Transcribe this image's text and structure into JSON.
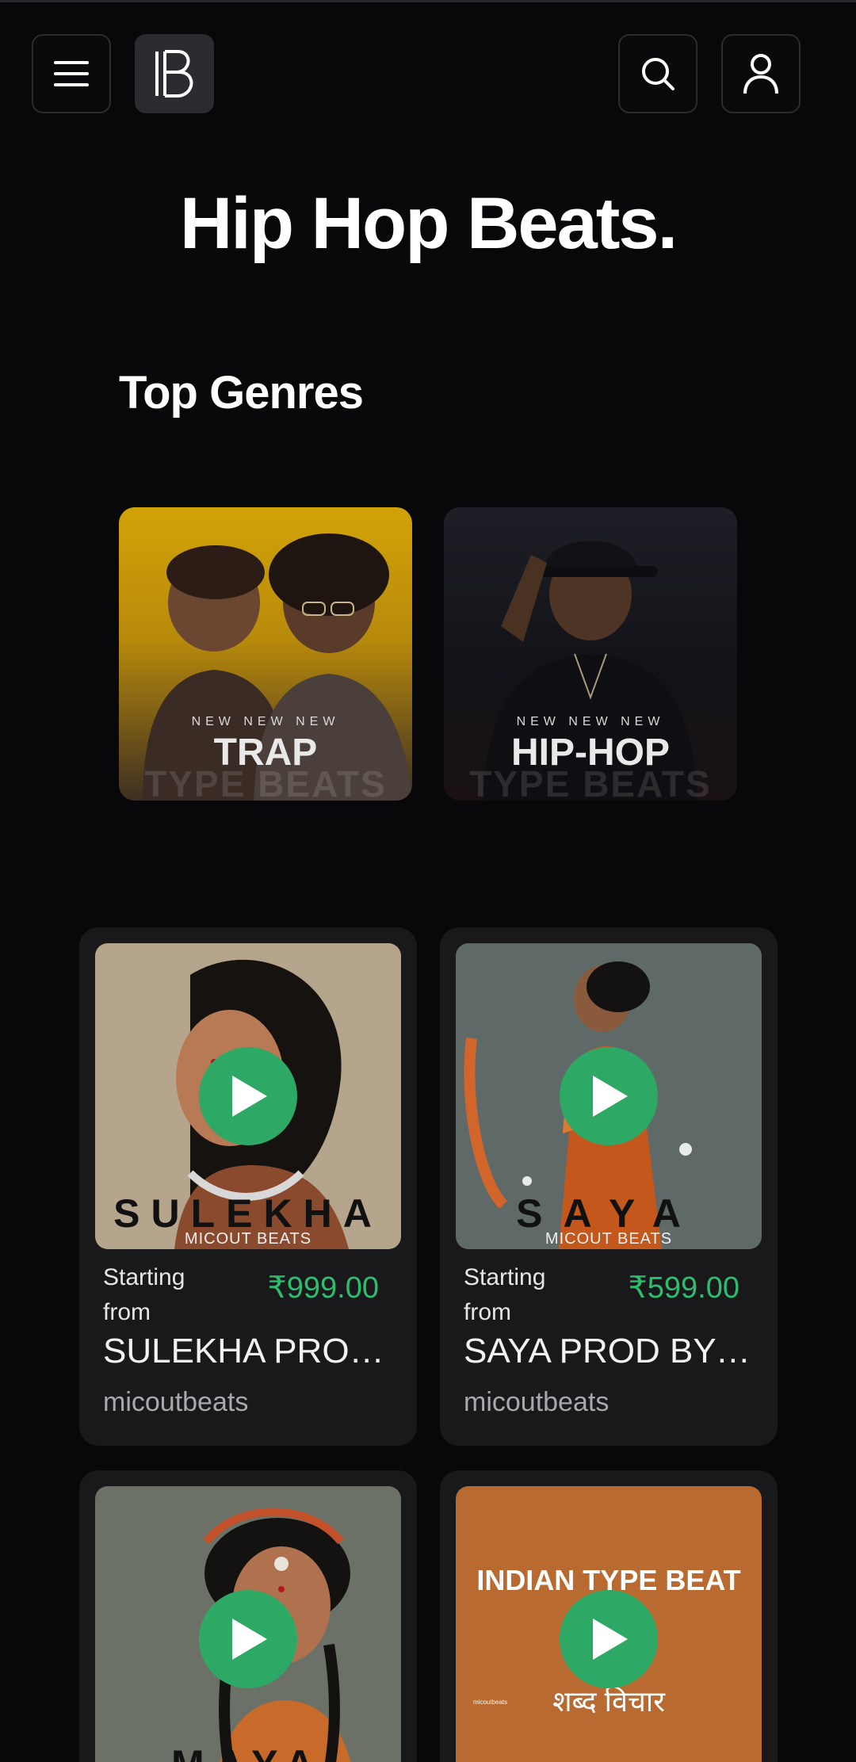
{
  "header": {
    "menu_icon": "hamburger-menu-icon",
    "logo_icon": "brand-b-logo-icon",
    "search_icon": "search-icon",
    "user_icon": "user-icon"
  },
  "page_title": "Hip Hop Beats.",
  "genres": {
    "title": "Top Genres",
    "items": [
      {
        "overline": "NEW NEW NEW",
        "name": "TRAP",
        "ghost": "TYPE BEATS"
      },
      {
        "overline": "NEW NEW NEW",
        "name": "HIP-HOP",
        "ghost": "TYPE BEATS"
      }
    ]
  },
  "beats": [
    {
      "cover_title": "SULEKHA",
      "cover_subtitle": "MICOUT BEATS",
      "price_label": "Starting from",
      "price": "₹999.00",
      "title": "SULEKHA PROD BY MICOUT BEATS",
      "author": "micoutbeats"
    },
    {
      "cover_title": "SAYA",
      "cover_subtitle": "MICOUT BEATS",
      "price_label": "Starting from",
      "price": "₹599.00",
      "title": "SAYA PROD BY MICOUT BEATS",
      "author": "micoutbeats"
    },
    {
      "cover_title": "MAYA"
    },
    {
      "cover_line1": "INDIAN TYPE BEAT",
      "cover_line2": "शब्द विचार",
      "cover_small": "micoutbeats"
    }
  ],
  "colors": {
    "background": "#08080b",
    "card": "#19191c",
    "accent_green": "#2ea865",
    "price_green": "#2ebd6e"
  }
}
